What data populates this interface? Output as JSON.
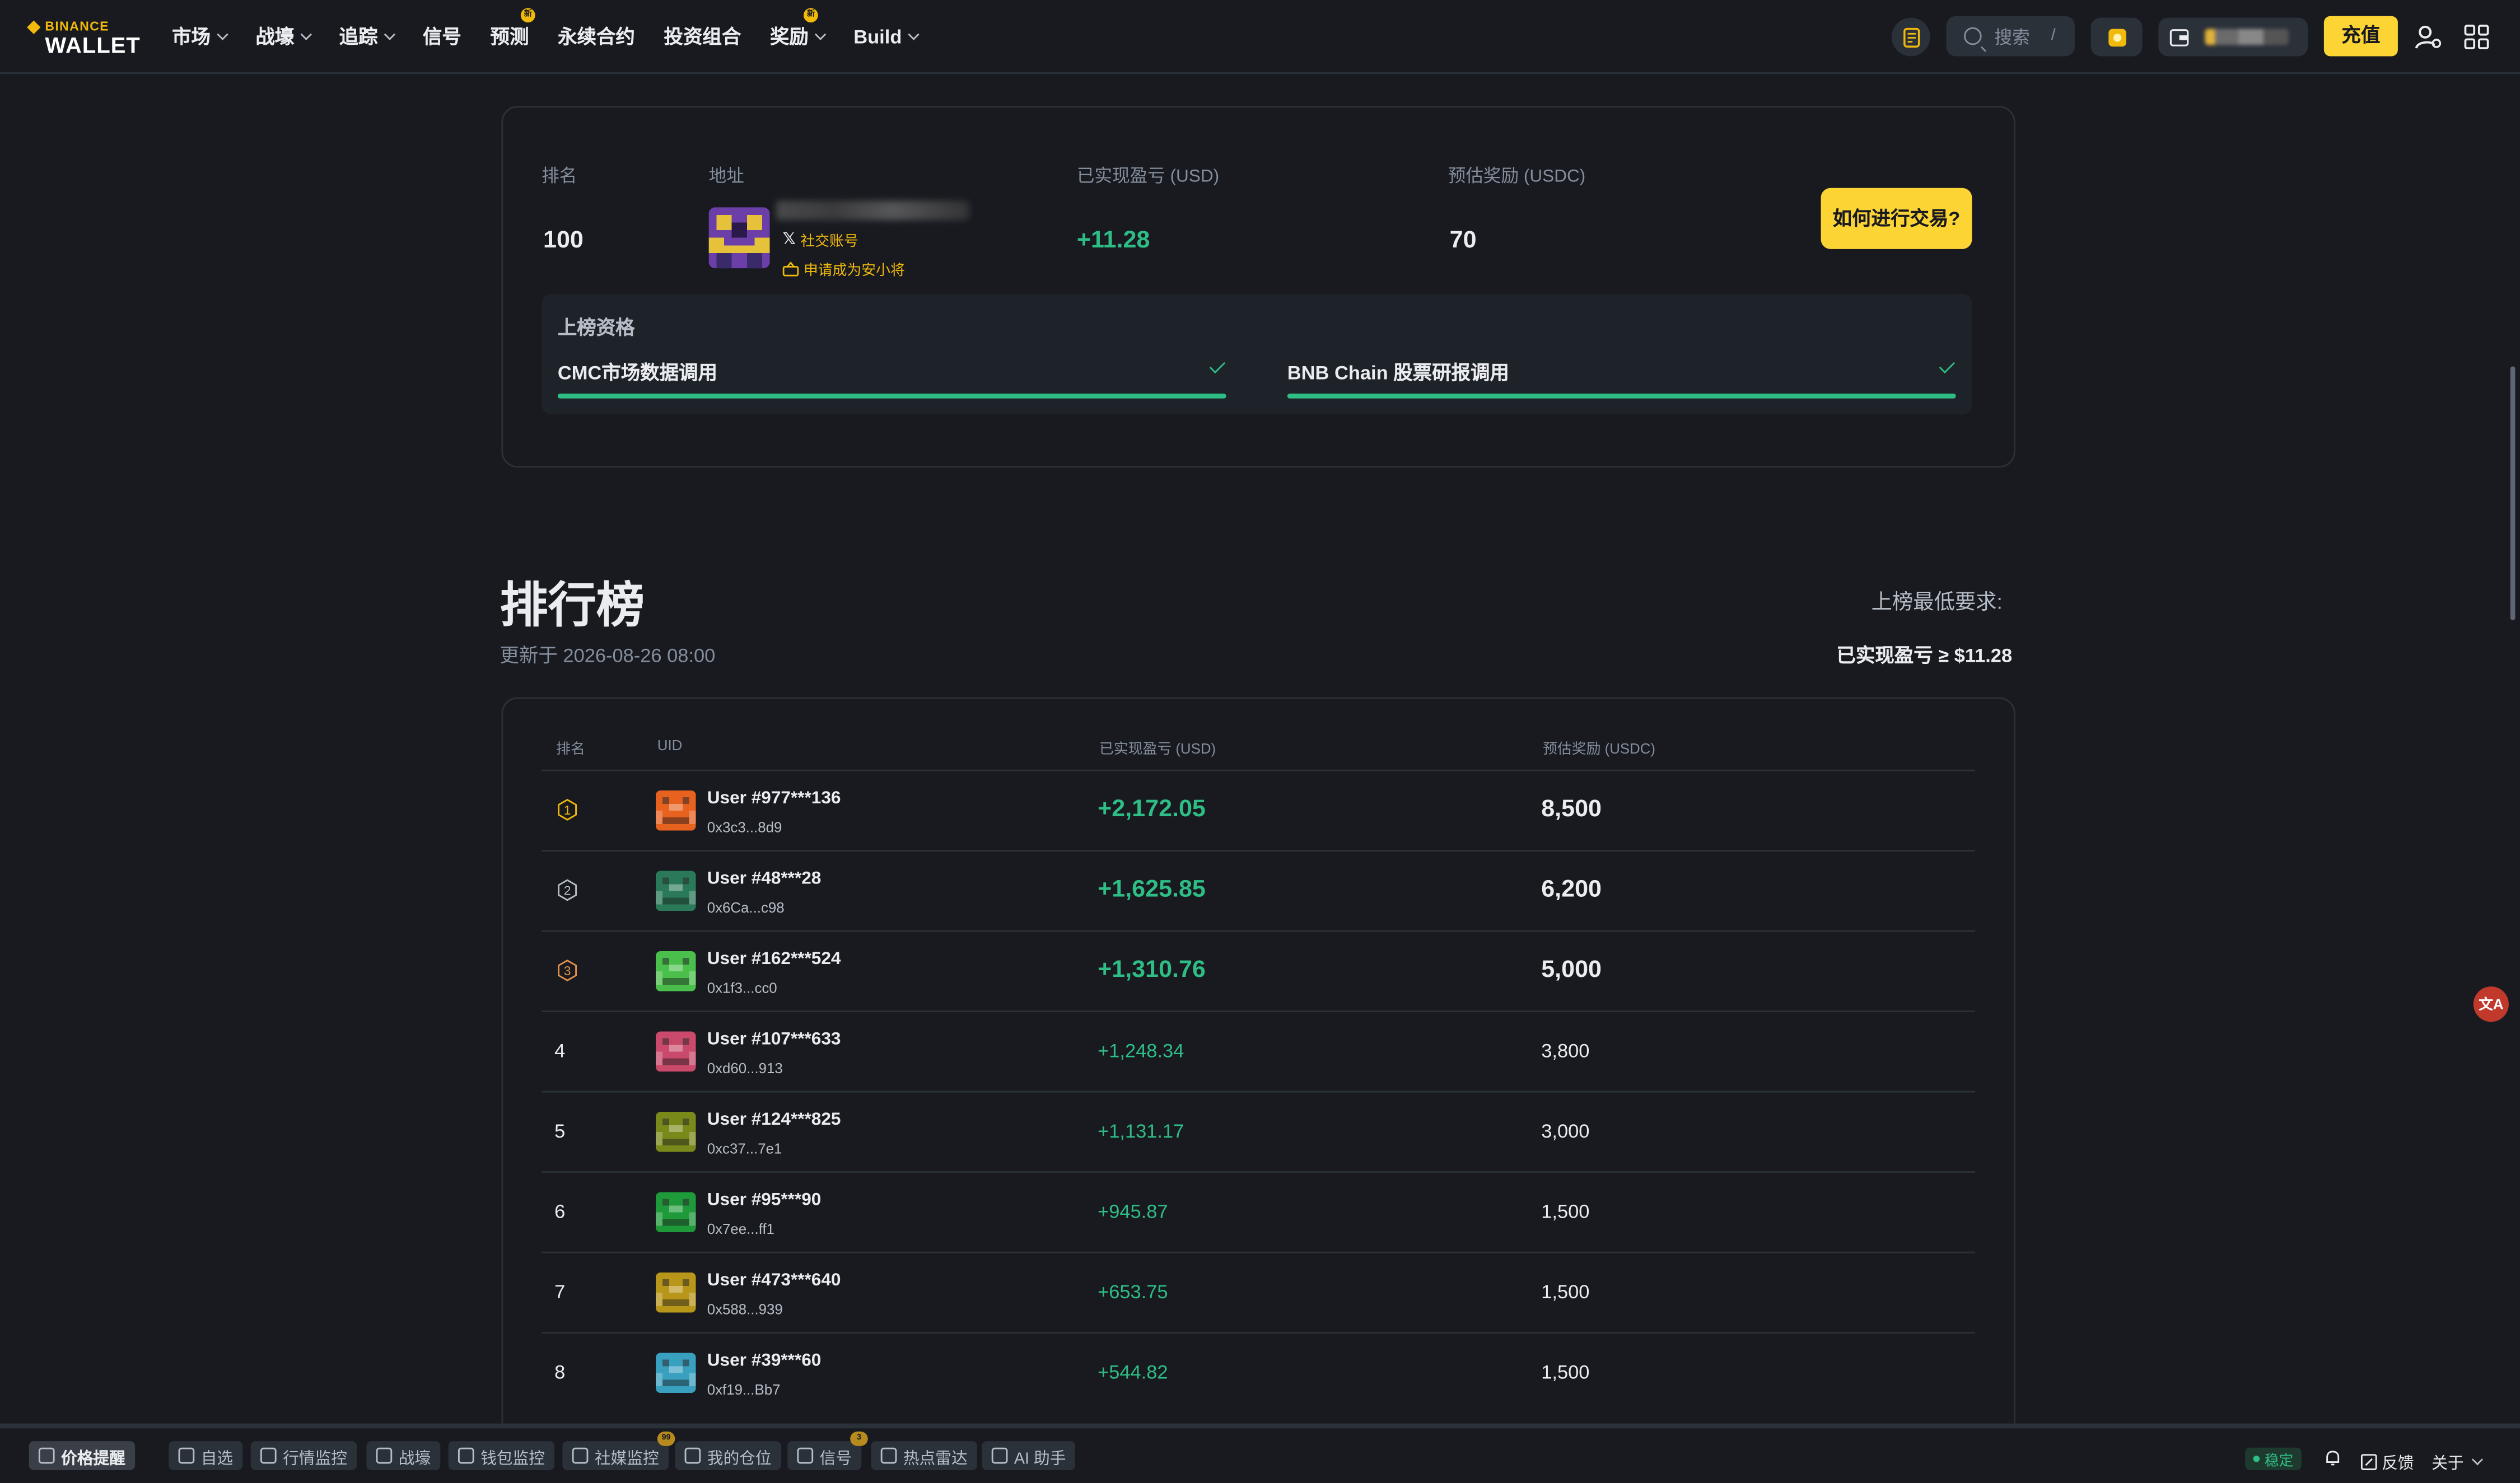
{
  "nav": {
    "logo_top": "BINANCE",
    "logo_bottom": "WALLET",
    "items": [
      {
        "label": "市场",
        "dropdown": true,
        "badge": ""
      },
      {
        "label": "战壕",
        "dropdown": true,
        "badge": ""
      },
      {
        "label": "追踪",
        "dropdown": true,
        "badge": ""
      },
      {
        "label": "信号",
        "dropdown": false,
        "badge": ""
      },
      {
        "label": "预测",
        "dropdown": false,
        "badge": "新"
      },
      {
        "label": "永续合约",
        "dropdown": false,
        "badge": ""
      },
      {
        "label": "投资组合",
        "dropdown": false,
        "badge": ""
      },
      {
        "label": "奖励",
        "dropdown": true,
        "badge": "新"
      },
      {
        "label": "Build",
        "dropdown": true,
        "badge": ""
      }
    ],
    "search_placeholder": "搜索",
    "search_shortcut": "/",
    "deposit_label": "充值"
  },
  "my_rank": {
    "headers": {
      "rank": "排名",
      "address": "地址",
      "pnl": "已实现盈亏 (USD)",
      "reward": "预估奖励 (USDC)"
    },
    "rank": "100",
    "social_label": "社交账号",
    "apply_label": "申请成为安小将",
    "pnl": "+11.28",
    "reward": "70",
    "how_to_trade": "如何进行交易?",
    "qualification_title": "上榜资格",
    "qualifications": [
      {
        "label": "CMC市场数据调用",
        "progress": 1.0
      },
      {
        "label": "BNB Chain 股票研报调用",
        "progress": 1.0
      }
    ]
  },
  "leaderboard": {
    "title": "排行榜",
    "updated": "更新于 2026-08-26 08:00",
    "min_label": "上榜最低要求:",
    "min_value": "已实现盈亏 ≥ $11.28",
    "columns": [
      "排名",
      "UID",
      "已实现盈亏 (USD)",
      "预估奖励 (USDC)"
    ],
    "rows": [
      {
        "rank": "1",
        "name": "User #977***136",
        "addr": "0x3c3...8d9",
        "pnl": "+2,172.05",
        "reward": "8,500",
        "color": "#e8621f"
      },
      {
        "rank": "2",
        "name": "User #48***28",
        "addr": "0x6Ca...c98",
        "pnl": "+1,625.85",
        "reward": "6,200",
        "color": "#2a7a5a"
      },
      {
        "rank": "3",
        "name": "User #162***524",
        "addr": "0x1f3...cc0",
        "pnl": "+1,310.76",
        "reward": "5,000",
        "color": "#4bbf4b"
      },
      {
        "rank": "4",
        "name": "User #107***633",
        "addr": "0xd60...913",
        "pnl": "+1,248.34",
        "reward": "3,800",
        "color": "#c94a6a"
      },
      {
        "rank": "5",
        "name": "User #124***825",
        "addr": "0xc37...7e1",
        "pnl": "+1,131.17",
        "reward": "3,000",
        "color": "#7a8a1a"
      },
      {
        "rank": "6",
        "name": "User #95***90",
        "addr": "0x7ee...ff1",
        "pnl": "+945.87",
        "reward": "1,500",
        "color": "#1f9a3a"
      },
      {
        "rank": "7",
        "name": "User #473***640",
        "addr": "0x588...939",
        "pnl": "+653.75",
        "reward": "1,500",
        "color": "#b8961a"
      },
      {
        "rank": "8",
        "name": "User #39***60",
        "addr": "0xf19...Bb7",
        "pnl": "+544.82",
        "reward": "1,500",
        "color": "#3aa0c0"
      }
    ]
  },
  "bottom_bar": {
    "items": [
      {
        "label": "价格提醒",
        "badge": ""
      },
      {
        "label": "自选",
        "badge": ""
      },
      {
        "label": "行情监控",
        "badge": ""
      },
      {
        "label": "战壕",
        "badge": ""
      },
      {
        "label": "钱包监控",
        "badge": ""
      },
      {
        "label": "社媒监控",
        "badge": "99"
      },
      {
        "label": "我的仓位",
        "badge": ""
      },
      {
        "label": "信号",
        "badge": "3"
      },
      {
        "label": "热点雷达",
        "badge": ""
      },
      {
        "label": "AI 助手",
        "badge": ""
      }
    ],
    "status": "稳定",
    "feedback": "反馈",
    "about": "关于"
  },
  "colors": {
    "accent": "#fcd535",
    "positive": "#2ebd85",
    "bg": "#181a20"
  }
}
